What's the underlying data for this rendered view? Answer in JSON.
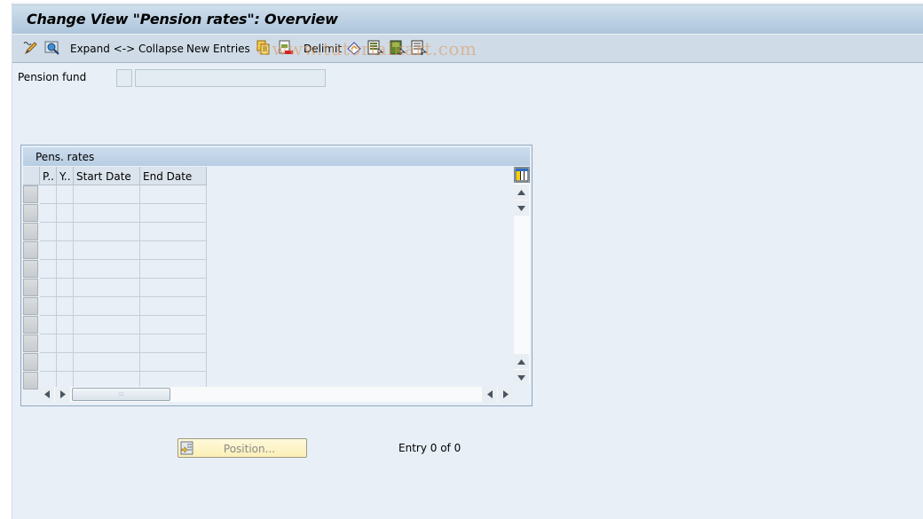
{
  "window": {
    "title": "Change View \"Pension rates\": Overview"
  },
  "toolbar": {
    "items": [
      {
        "type": "icon",
        "icon": "display-change-icon"
      },
      {
        "type": "icon",
        "icon": "find-icon"
      },
      {
        "type": "button",
        "label": "Expand <-> Collapse"
      },
      {
        "type": "button",
        "label": "New Entries"
      },
      {
        "type": "icon",
        "icon": "copy-as-icon"
      },
      {
        "type": "icon",
        "icon": "delete-icon"
      },
      {
        "type": "button",
        "label": "Delimit"
      },
      {
        "type": "icon",
        "icon": "undo-change-icon"
      },
      {
        "type": "icon",
        "icon": "select-all-icon"
      },
      {
        "type": "icon",
        "icon": "select-block-icon"
      },
      {
        "type": "icon",
        "icon": "deselect-all-icon"
      }
    ],
    "expand_label": "Expand <-> Collapse",
    "new_entries_label": "New Entries",
    "delimit_label": "Delimit",
    "watermark": "©www.tutorialkart.com"
  },
  "filter": {
    "pension_fund_label": "Pension fund",
    "pension_fund_key": "",
    "pension_fund_text": ""
  },
  "table": {
    "caption": "Pens. rates",
    "columns": [
      {
        "key": "p",
        "label": "P.."
      },
      {
        "key": "y",
        "label": "Y.."
      },
      {
        "key": "start_date",
        "label": "Start Date"
      },
      {
        "key": "end_date",
        "label": "End Date"
      }
    ],
    "rows": [],
    "empty_row_count": 11,
    "settings_icon": "table-settings-icon"
  },
  "footer": {
    "position_button_label": "Position...",
    "entry_status": "Entry 0 of 0"
  }
}
